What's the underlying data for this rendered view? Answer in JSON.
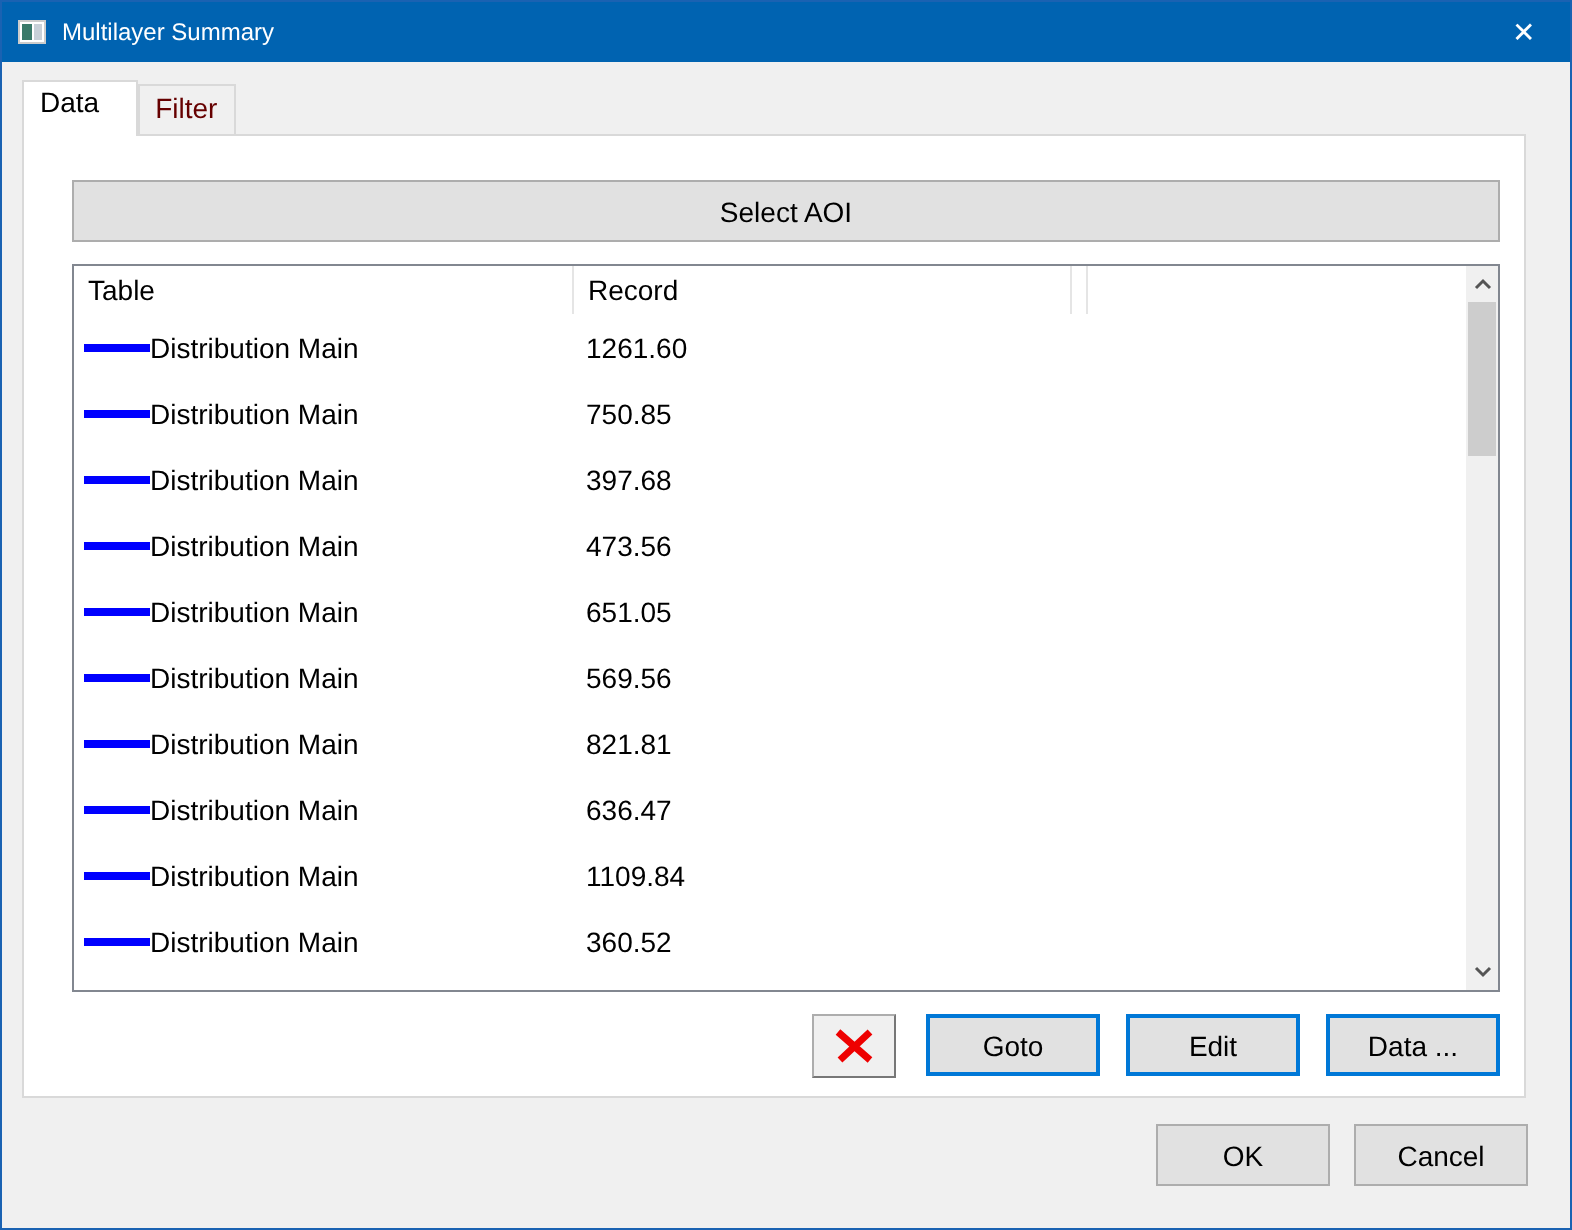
{
  "window": {
    "title": "Multilayer Summary",
    "close": "✕"
  },
  "tabs": [
    {
      "label": "Data",
      "selected": true
    },
    {
      "label": "Filter",
      "selected": false
    }
  ],
  "select_button": "Select AOI",
  "table": {
    "columns": [
      "Table",
      "Record"
    ],
    "rows": [
      {
        "table": "Distribution Main",
        "record": "1261.60",
        "color": "#0000ff"
      },
      {
        "table": "Distribution Main",
        "record": "750.85",
        "color": "#0000ff"
      },
      {
        "table": "Distribution Main",
        "record": "397.68",
        "color": "#0000ff"
      },
      {
        "table": "Distribution Main",
        "record": "473.56",
        "color": "#0000ff"
      },
      {
        "table": "Distribution Main",
        "record": "651.05",
        "color": "#0000ff"
      },
      {
        "table": "Distribution Main",
        "record": "569.56",
        "color": "#0000ff"
      },
      {
        "table": "Distribution Main",
        "record": "821.81",
        "color": "#0000ff"
      },
      {
        "table": "Distribution Main",
        "record": "636.47",
        "color": "#0000ff"
      },
      {
        "table": "Distribution Main",
        "record": "1109.84",
        "color": "#0000ff"
      },
      {
        "table": "Distribution Main",
        "record": "360.52",
        "color": "#0000ff"
      }
    ]
  },
  "actions": [
    "Goto",
    "Edit",
    "Data ..."
  ],
  "buttons": [
    "OK",
    "Cancel"
  ]
}
